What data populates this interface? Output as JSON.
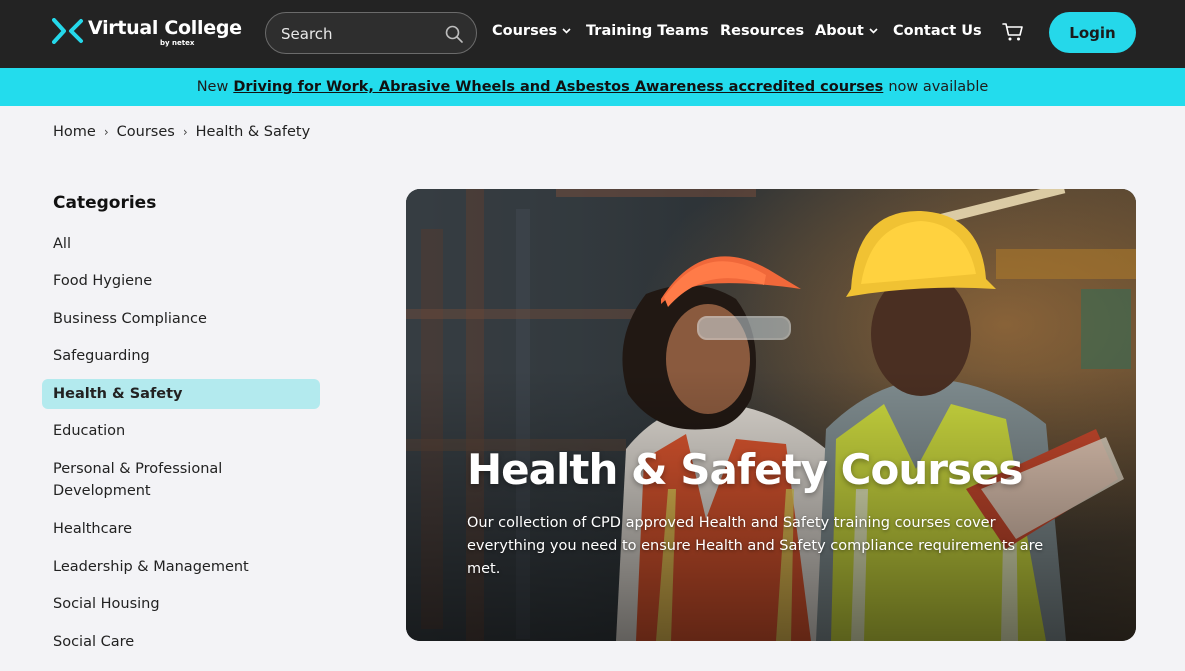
{
  "brand": {
    "name": "Virtual College",
    "sub": "by netex"
  },
  "search": {
    "placeholder": "Search"
  },
  "nav": {
    "courses": "Courses",
    "training_teams": "Training Teams",
    "resources": "Resources",
    "about": "About",
    "contact": "Contact Us",
    "login": "Login"
  },
  "banner": {
    "prefix": "New",
    "link": "Driving for Work, Abrasive Wheels and Asbestos Awareness accredited courses",
    "suffix": "now available"
  },
  "breadcrumb": {
    "home": "Home",
    "courses": "Courses",
    "current": "Health & Safety"
  },
  "sidebar": {
    "title": "Categories",
    "items": [
      {
        "label": "All"
      },
      {
        "label": "Food Hygiene"
      },
      {
        "label": "Business Compliance"
      },
      {
        "label": "Safeguarding"
      },
      {
        "label": "Health & Safety",
        "active": true
      },
      {
        "label": "Education"
      },
      {
        "label": "Personal & Professional Development"
      },
      {
        "label": "Healthcare"
      },
      {
        "label": "Leadership & Management"
      },
      {
        "label": "Social Housing"
      },
      {
        "label": "Social Care"
      }
    ]
  },
  "hero": {
    "title": "Health & Safety Courses",
    "description": "Our collection of CPD approved Health and Safety training courses cover everything you need to ensure Health and Safety compliance requirements are met."
  },
  "colors": {
    "accent": "#23dced",
    "header": "#232323",
    "active_category": "#b3eaee"
  }
}
